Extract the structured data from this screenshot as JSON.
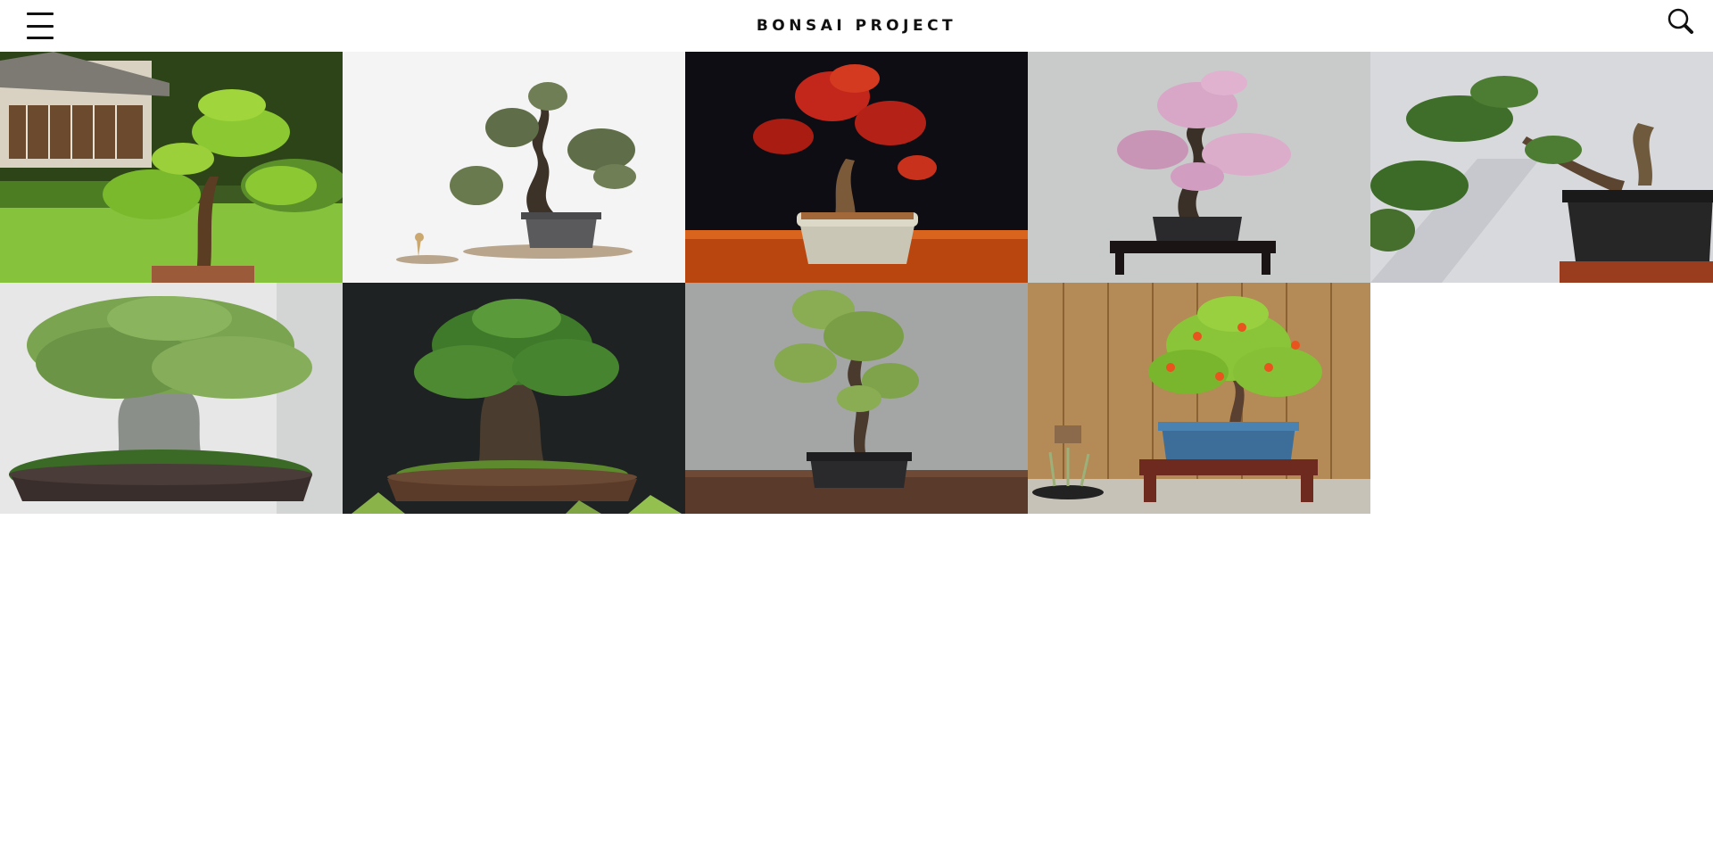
{
  "header": {
    "title": "BONSAI PROJECT",
    "menu_icon": "hamburger-menu-icon",
    "search_icon": "search-icon"
  },
  "gallery": {
    "items": [
      {
        "subject": "juniper-garden"
      },
      {
        "subject": "white-pine"
      },
      {
        "subject": "red-maple"
      },
      {
        "subject": "cherry-blossom"
      },
      {
        "subject": "cascade-juniper"
      },
      {
        "subject": "ficus"
      },
      {
        "subject": "forest-ficus"
      },
      {
        "subject": "jade"
      },
      {
        "subject": "pomegranate"
      }
    ]
  }
}
